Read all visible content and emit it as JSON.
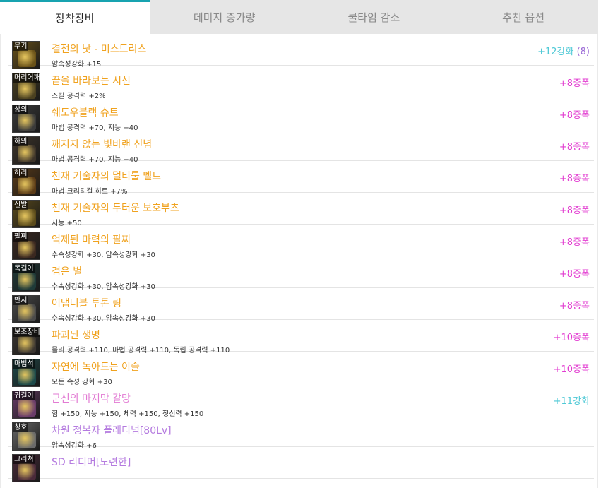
{
  "tabs": [
    {
      "label": "장착장비",
      "active": true
    },
    {
      "label": "데미지 증가량",
      "active": false
    },
    {
      "label": "쿨타임 감소",
      "active": false
    },
    {
      "label": "추천 옵션",
      "active": false
    }
  ],
  "colors": {
    "accent_tab": "#18a3b0",
    "item_name_orange": "#f0a21e",
    "item_name_purple": "#b47adf",
    "item_name_pink": "#e27ad3",
    "badge_reinforce": "#4fc9d6",
    "badge_amplify": "#e23bd0",
    "count": "#9b6ad6"
  },
  "items": [
    {
      "slot": "무기",
      "icon": "weapon-icon",
      "name": "결전의 낫 - 미스트리스",
      "name_color": "orange",
      "stat": "암속성강화 +15",
      "badge": "+12강화",
      "badge_type": "reinforce",
      "count": "(8)",
      "icon_bg": "#6a5218"
    },
    {
      "slot": "머리어깨",
      "icon": "shoulder-armor-icon",
      "name": "끝을 바라보는 시선",
      "name_color": "orange",
      "stat": "스킬 공격력 +2%",
      "badge": "+8증폭",
      "badge_type": "amplify",
      "count": "",
      "icon_bg": "#4a4020"
    },
    {
      "slot": "상의",
      "icon": "top-armor-icon",
      "name": "쉐도우블랙 슈트",
      "name_color": "orange",
      "stat": "마법 공격력 +70, 지능 +40",
      "badge": "+8증폭",
      "badge_type": "amplify",
      "count": "",
      "icon_bg": "#3a3a3a"
    },
    {
      "slot": "하의",
      "icon": "pants-armor-icon",
      "name": "깨지지 않는 빛바랜 신념",
      "name_color": "orange",
      "stat": "마법 공격력 +70, 지능 +40",
      "badge": "+8증폭",
      "badge_type": "amplify",
      "count": "",
      "icon_bg": "#3d342a"
    },
    {
      "slot": "허리",
      "icon": "belt-icon",
      "name": "천재 기술자의 멀티툴 벨트",
      "name_color": "orange",
      "stat": "마법 크리티컬 히트 +7%",
      "badge": "+8증폭",
      "badge_type": "amplify",
      "count": "",
      "icon_bg": "#5a3a16"
    },
    {
      "slot": "신발",
      "icon": "boots-icon",
      "name": "천재 기술자의 두터운 보호부츠",
      "name_color": "orange",
      "stat": "지능 +50",
      "badge": "+8증폭",
      "badge_type": "amplify",
      "count": "",
      "icon_bg": "#5a4a1a"
    },
    {
      "slot": "팔찌",
      "icon": "bracelet-icon",
      "name": "억제된 마력의 팔찌",
      "name_color": "orange",
      "stat": "수속성강화 +30, 암속성강화 +30",
      "badge": "+8증폭",
      "badge_type": "amplify",
      "count": "",
      "icon_bg": "#3a2820"
    },
    {
      "slot": "목걸이",
      "icon": "necklace-icon",
      "name": "검은 별",
      "name_color": "orange",
      "stat": "수속성강화 +30, 암속성강화 +30",
      "badge": "+8증폭",
      "badge_type": "amplify",
      "count": "",
      "icon_bg": "#1f3a38"
    },
    {
      "slot": "반지",
      "icon": "ring-icon",
      "name": "어댑터블 투톤 링",
      "name_color": "orange",
      "stat": "수속성강화 +30, 암속성강화 +30",
      "badge": "+8증폭",
      "badge_type": "amplify",
      "count": "",
      "icon_bg": "#4a4a4a"
    },
    {
      "slot": "보조장비",
      "icon": "sub-equipment-icon",
      "name": "파괴된 생명",
      "name_color": "orange",
      "stat": "물리 공격력 +110, 마법 공격력 +110, 독립 공격력 +110",
      "badge": "+10증폭",
      "badge_type": "amplify",
      "count": "",
      "icon_bg": "#3a3530"
    },
    {
      "slot": "마법석",
      "icon": "magic-stone-icon",
      "name": "자연에 녹아드는 이슬",
      "name_color": "orange",
      "stat": "모든 속성 강화 +30",
      "badge": "+10증폭",
      "badge_type": "amplify",
      "count": "",
      "icon_bg": "#1d4a4a"
    },
    {
      "slot": "귀걸이",
      "icon": "earring-icon",
      "name": "군신의 마지막 갈망",
      "name_color": "pink",
      "stat": "힘 +150, 지능 +150, 체력 +150, 정신력 +150",
      "badge": "+11강화",
      "badge_type": "reinforce",
      "count": "",
      "icon_bg": "#6a3c6a"
    },
    {
      "slot": "칭호",
      "icon": "title-icon",
      "name": "차원 정복자 플래티넘[80Lv]",
      "name_color": "purple",
      "stat": "암속성강화 +6",
      "badge": "",
      "badge_type": "",
      "count": "",
      "icon_bg": "#6a6a6a"
    },
    {
      "slot": "크리쳐",
      "icon": "creature-icon",
      "name": "SD 리디머[노련한]",
      "name_color": "purple",
      "stat": "",
      "badge": "",
      "badge_type": "",
      "count": "",
      "icon_bg": "#4a2a3a"
    }
  ]
}
